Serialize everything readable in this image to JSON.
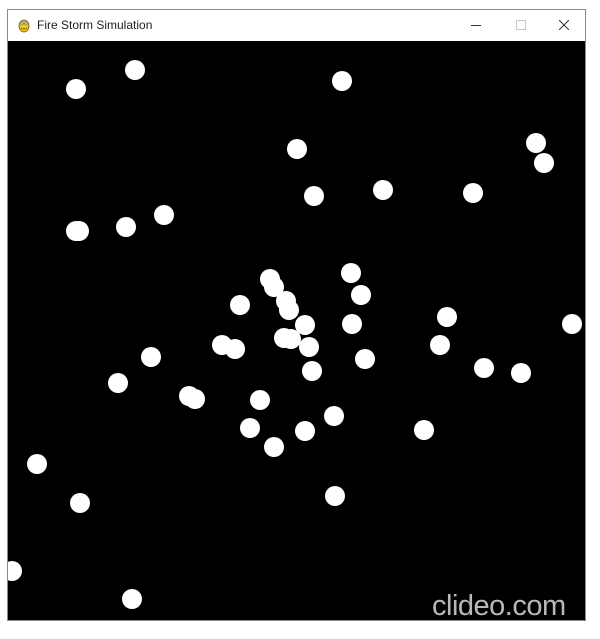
{
  "window": {
    "title": "Fire Storm Simulation",
    "icon": "pygame-snake-icon",
    "controls": [
      "minimize",
      "maximize",
      "close"
    ]
  },
  "simulation": {
    "background_color": "#000000",
    "particle_color": "#ffffff",
    "particle_count": 56
  },
  "watermark": {
    "text": "clideo.com"
  }
}
